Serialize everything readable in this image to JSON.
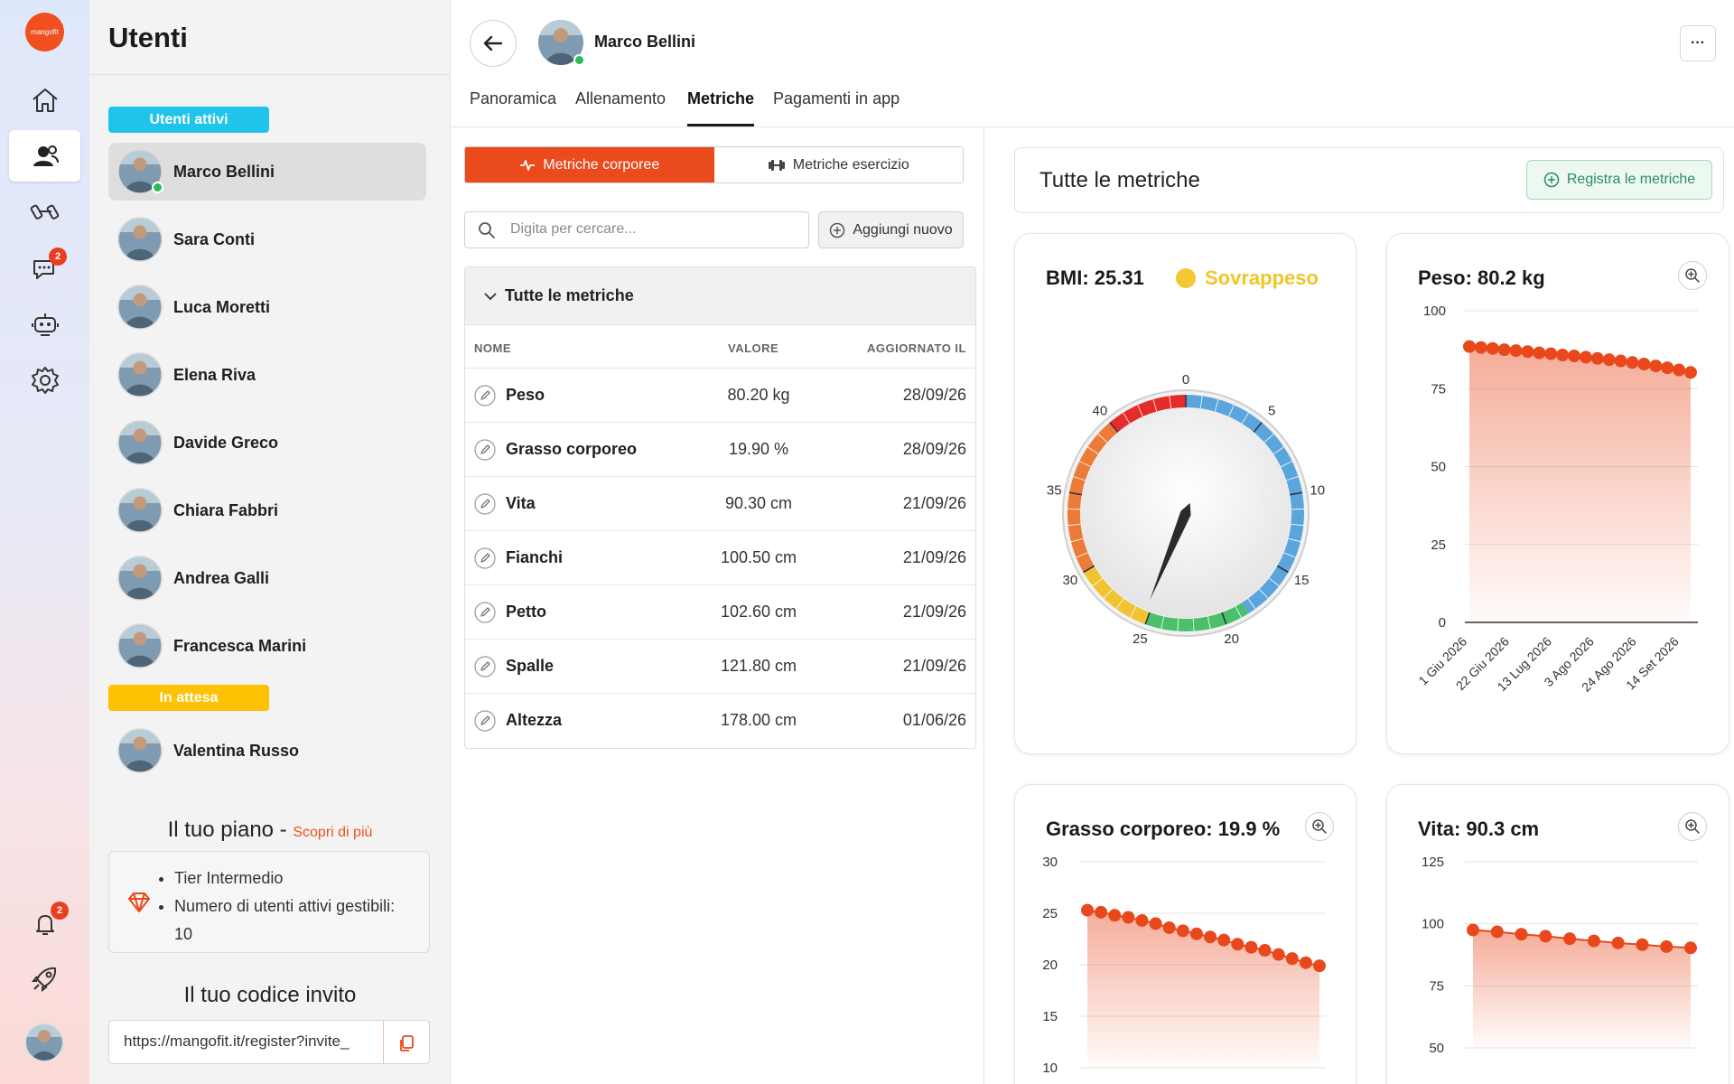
{
  "app": {
    "logo_text": "mangofit"
  },
  "rail": {
    "chat_badge": "2",
    "notifications_badge": "2"
  },
  "users": {
    "title": "Utenti",
    "active_label": "Utenti attivi",
    "pending_label": "In attesa",
    "active_users": [
      "Marco Bellini",
      "Sara Conti",
      "Luca Moretti",
      "Elena Riva",
      "Davide Greco",
      "Chiara Fabbri",
      "Andrea Galli",
      "Francesca Marini"
    ],
    "pending_users": [
      "Valentina Russo"
    ]
  },
  "plan": {
    "title": "Il tuo piano",
    "separator": " - ",
    "discover_link": "Scopri di più",
    "items": [
      "Tier Intermedio",
      "Numero di utenti attivi gestibili: 10"
    ]
  },
  "invite": {
    "title": "Il tuo codice invito",
    "url": "https://mangofit.it/register?invite_"
  },
  "header": {
    "user_name": "Marco Bellini",
    "more_label": "···",
    "tabs": [
      "Panoramica",
      "Allenamento",
      "Metriche",
      "Pagamenti in app"
    ],
    "active_tab": "Metriche"
  },
  "metrics": {
    "segment_body": "Metriche corporee",
    "segment_exercise": "Metriche esercizio",
    "search_placeholder": "Digita per cercare...",
    "add_label": "Aggiungi nuovo",
    "group_label": "Tutte le metriche",
    "columns": {
      "name": "NOME",
      "value": "VALORE",
      "updated": "AGGIORNATO IL"
    },
    "rows": [
      {
        "name": "Peso",
        "value": "80.20 kg",
        "date": "28/09/26"
      },
      {
        "name": "Grasso corporeo",
        "value": "19.90 %",
        "date": "28/09/26"
      },
      {
        "name": "Vita",
        "value": "90.30 cm",
        "date": "21/09/26"
      },
      {
        "name": "Fianchi",
        "value": "100.50 cm",
        "date": "21/09/26"
      },
      {
        "name": "Petto",
        "value": "102.60 cm",
        "date": "21/09/26"
      },
      {
        "name": "Spalle",
        "value": "121.80 cm",
        "date": "21/09/26"
      },
      {
        "name": "Altezza",
        "value": "178.00 cm",
        "date": "01/06/26"
      }
    ]
  },
  "overview": {
    "title": "Tutte le metriche",
    "register_label": "Registra le metriche"
  },
  "bmi": {
    "title": "BMI: 25.31",
    "category": "Sovrappeso",
    "category_color": "#f0c528"
  },
  "colors": {
    "accent": "#ea4a1c",
    "series": "#e8481c",
    "success": "#2a8e5d"
  },
  "chart_data": [
    {
      "type": "gauge",
      "title": "BMI: 25.31",
      "value": 25.31,
      "range": [
        0,
        45
      ],
      "tick_labels": [
        "0",
        "5",
        "10",
        "15",
        "20",
        "25",
        "30",
        "35",
        "40"
      ],
      "bands": [
        {
          "from": 0,
          "to": 18.5,
          "color": "#5aa6dc"
        },
        {
          "from": 18.5,
          "to": 25,
          "color": "#4cbf6a"
        },
        {
          "from": 25,
          "to": 30,
          "color": "#f1c232"
        },
        {
          "from": 30,
          "to": 40,
          "color": "#ec7a38"
        },
        {
          "from": 40,
          "to": 45,
          "color": "#e62b2b"
        }
      ]
    },
    {
      "type": "area",
      "title": "Peso: 80.2 kg",
      "ylim": [
        0,
        100
      ],
      "y_ticks": [
        0,
        25,
        50,
        75,
        100
      ],
      "x_tick_labels": [
        "1 Giu 2026",
        "22 Giu 2026",
        "13 Lug 2026",
        "3 Ago 2026",
        "24 Ago 2026",
        "14 Set 2026"
      ],
      "series": [
        {
          "values": [
            88.5,
            88.2,
            87.9,
            87.5,
            87.2,
            86.9,
            86.5,
            86.2,
            85.8,
            85.5,
            85.1,
            84.7,
            84.3,
            83.9,
            83.4,
            82.9,
            82.3,
            81.7,
            81.0,
            80.2
          ]
        }
      ]
    },
    {
      "type": "area",
      "title": "Grasso corporeo: 19.9 %",
      "ylim": [
        10,
        30
      ],
      "y_ticks": [
        10,
        15,
        20,
        25,
        30
      ],
      "series": [
        {
          "values": [
            25.3,
            25.1,
            24.8,
            24.6,
            24.3,
            24.0,
            23.6,
            23.3,
            23.0,
            22.7,
            22.4,
            22.0,
            21.7,
            21.4,
            21.0,
            20.6,
            20.2,
            19.9
          ]
        }
      ]
    },
    {
      "type": "area",
      "title": "Vita: 90.3 cm",
      "ylim": [
        50,
        125
      ],
      "y_ticks": [
        50,
        75,
        100,
        125
      ],
      "series": [
        {
          "values": [
            97.5,
            96.8,
            95.8,
            95.0,
            94.0,
            93.1,
            92.3,
            91.6,
            90.8,
            90.3
          ]
        }
      ]
    }
  ]
}
